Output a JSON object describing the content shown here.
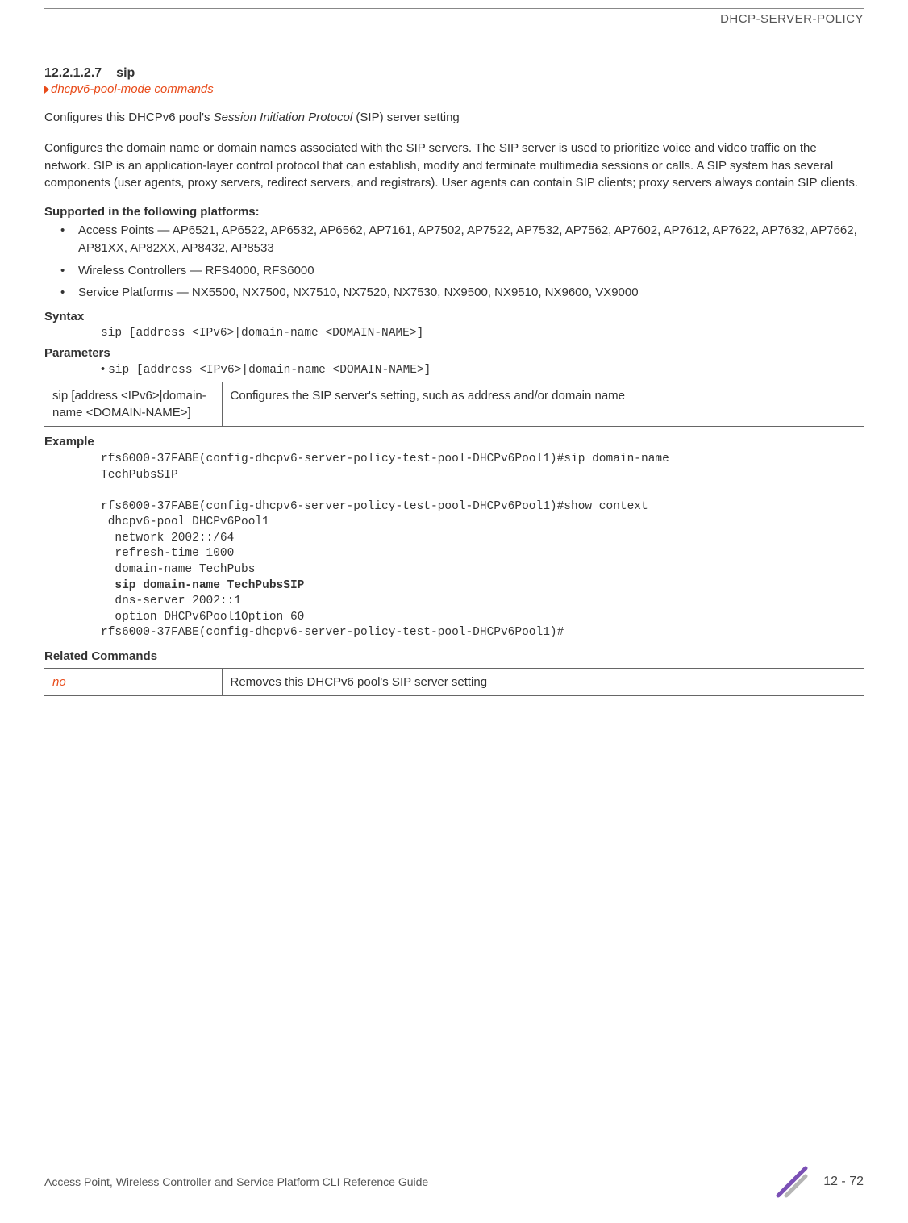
{
  "header": {
    "chapter": "DHCP-SERVER-POLICY"
  },
  "section": {
    "number": "12.2.1.2.7",
    "title": "sip",
    "breadcrumb": "dhcpv6-pool-mode commands"
  },
  "intro": {
    "p1_a": "Configures this DHCPv6 pool's ",
    "p1_italic": "Session Initiation Protocol",
    "p1_b": " (SIP) server setting",
    "p2": "Configures the domain name or domain names associated with the SIP servers. The SIP server is used to prioritize voice and video traffic on the network. SIP is an application-layer control protocol that can establish, modify and terminate multimedia sessions or calls. A SIP system has several components (user agents, proxy servers, redirect servers, and registrars). User agents can contain SIP clients; proxy servers always contain SIP clients."
  },
  "platforms": {
    "heading": "Supported in the following platforms:",
    "items": [
      "Access Points — AP6521, AP6522, AP6532, AP6562, AP7161, AP7502, AP7522, AP7532, AP7562, AP7602, AP7612, AP7622, AP7632, AP7662, AP81XX, AP82XX, AP8432, AP8533",
      "Wireless Controllers — RFS4000, RFS6000",
      "Service Platforms — NX5500, NX7500, NX7510, NX7520, NX7530, NX9500, NX9510, NX9600, VX9000"
    ]
  },
  "syntax": {
    "heading": "Syntax",
    "line": "sip [address <IPv6>|domain-name <DOMAIN-NAME>]"
  },
  "parameters": {
    "heading": "Parameters",
    "bullet": "sip [address <IPv6>|domain-name <DOMAIN-NAME>]",
    "table": {
      "left": "sip [address <IPv6>|domain-name <DOMAIN-NAME>]",
      "right": "Configures the SIP server's setting, such as address and/or domain name"
    }
  },
  "example": {
    "heading": "Example",
    "l1": "rfs6000-37FABE(config-dhcpv6-server-policy-test-pool-DHCPv6Pool1)#sip domain-name",
    "l2": "TechPubsSIP",
    "l3": "rfs6000-37FABE(config-dhcpv6-server-policy-test-pool-DHCPv6Pool1)#show context",
    "l4": " dhcpv6-pool DHCPv6Pool1",
    "l5": "  network 2002::/64",
    "l6": "  refresh-time 1000",
    "l7": "  domain-name TechPubs",
    "l8": "  sip domain-name TechPubsSIP",
    "l9": "  dns-server 2002::1",
    "l10": "  option DHCPv6Pool1Option 60",
    "l11": "rfs6000-37FABE(config-dhcpv6-server-policy-test-pool-DHCPv6Pool1)#"
  },
  "related": {
    "heading": "Related Commands",
    "table": {
      "left": "no",
      "right": "Removes this DHCPv6 pool's SIP server setting"
    }
  },
  "footer": {
    "text": "Access Point, Wireless Controller and Service Platform CLI Reference Guide",
    "page": "12 - 72"
  }
}
